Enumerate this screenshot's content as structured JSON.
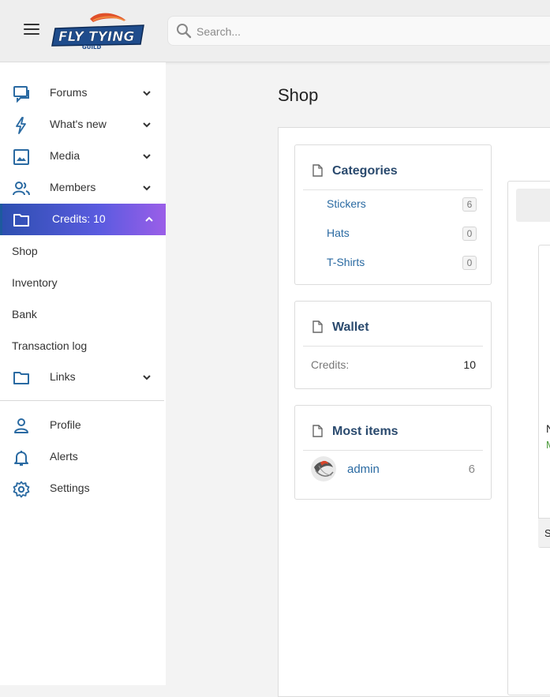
{
  "header": {
    "search_placeholder": "Search...",
    "logo_alt": "FLY TYING GUILD"
  },
  "sidebar": {
    "items": [
      {
        "label": "Forums",
        "icon": "forums-icon"
      },
      {
        "label": "What's new",
        "icon": "lightning-icon"
      },
      {
        "label": "Media",
        "icon": "image-icon"
      },
      {
        "label": "Members",
        "icon": "members-icon"
      },
      {
        "label": "Credits: 10",
        "icon": "folder-icon"
      }
    ],
    "sub_items": [
      "Shop",
      "Inventory",
      "Bank",
      "Transaction log"
    ],
    "links": {
      "label": "Links",
      "icon": "folder-icon"
    },
    "account": [
      {
        "label": "Profile",
        "icon": "user-icon"
      },
      {
        "label": "Alerts",
        "icon": "bell-icon"
      },
      {
        "label": "Settings",
        "icon": "gear-icon"
      }
    ]
  },
  "main": {
    "title": "Shop",
    "categories": {
      "title": "Categories",
      "items": [
        {
          "name": "Stickers",
          "count": "6"
        },
        {
          "name": "Hats",
          "count": "0"
        },
        {
          "name": "T-Shirts",
          "count": "0"
        }
      ]
    },
    "wallet": {
      "title": "Wallet",
      "label": "Credits:",
      "value": "10"
    },
    "most_items": {
      "title": "Most items",
      "user": "admin",
      "count": "6"
    },
    "fragments": {
      "item_initial": "N",
      "item_sub": "M",
      "foot": "S"
    }
  },
  "colors": {
    "accent": "#2a6aa2",
    "title_blue": "#2a4a6e",
    "active_gradient_start": "#2d4fb0",
    "active_gradient_end": "#9b5ee8"
  }
}
